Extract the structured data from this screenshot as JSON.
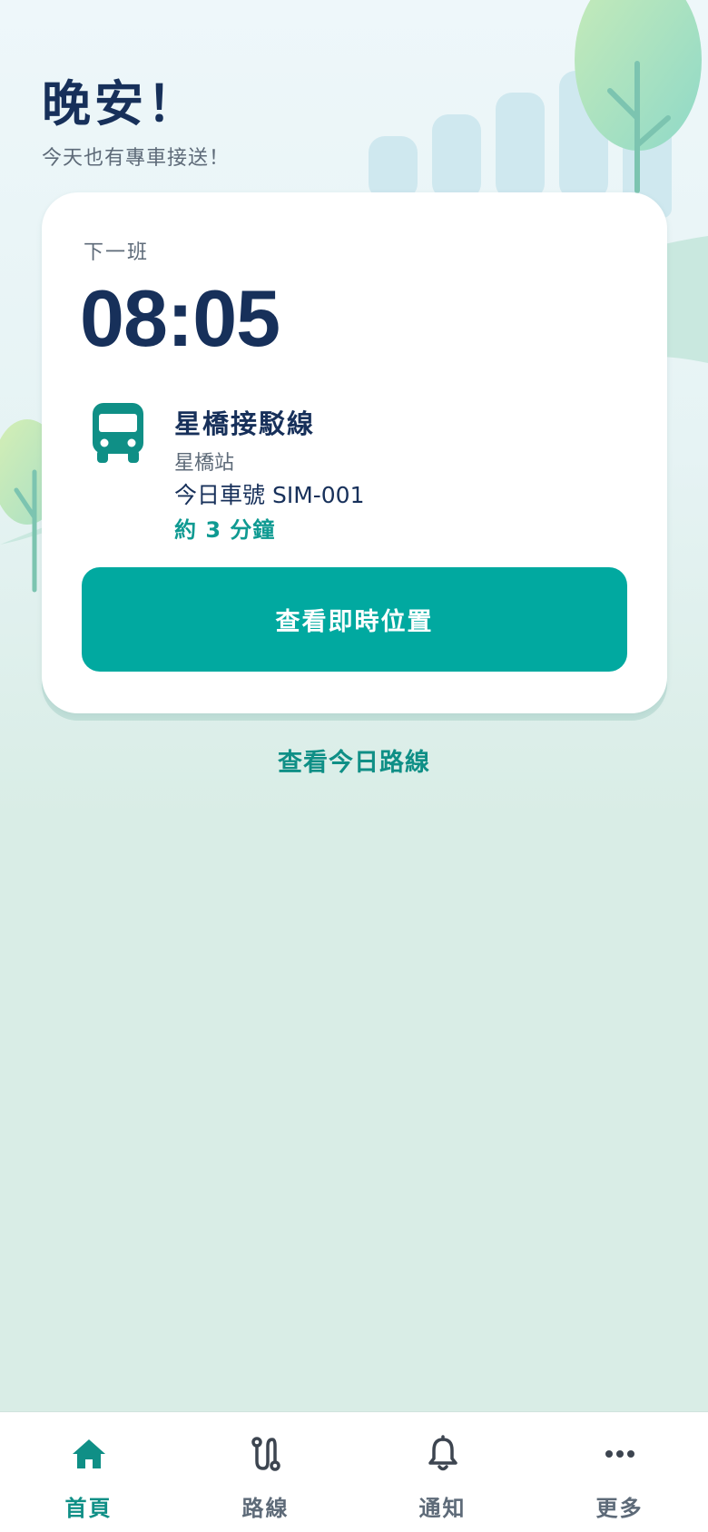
{
  "header": {
    "greeting": "晚安！",
    "subtitle": "今天也有專車接送！"
  },
  "next_ride": {
    "label": "下一班",
    "time": "08:05",
    "route_name": "星橋接駁線",
    "station": "星橋站",
    "plate": "今日車號 SIM-001",
    "eta": "約 3 分鐘",
    "primary_button": "查看即時位置"
  },
  "links": {
    "today_route": "查看今日路線"
  },
  "tabbar": {
    "items": [
      {
        "label": "首頁",
        "icon": "home-icon",
        "active": true
      },
      {
        "label": "路線",
        "icon": "route-icon",
        "active": false
      },
      {
        "label": "通知",
        "icon": "bell-icon",
        "active": false
      },
      {
        "label": "更多",
        "icon": "more-icon",
        "active": false
      }
    ]
  },
  "colors": {
    "accent": "#01a9a0",
    "accent_text": "#0f8f86",
    "title": "#17305a",
    "muted": "#5d6a78",
    "background": "#d9ede6"
  }
}
